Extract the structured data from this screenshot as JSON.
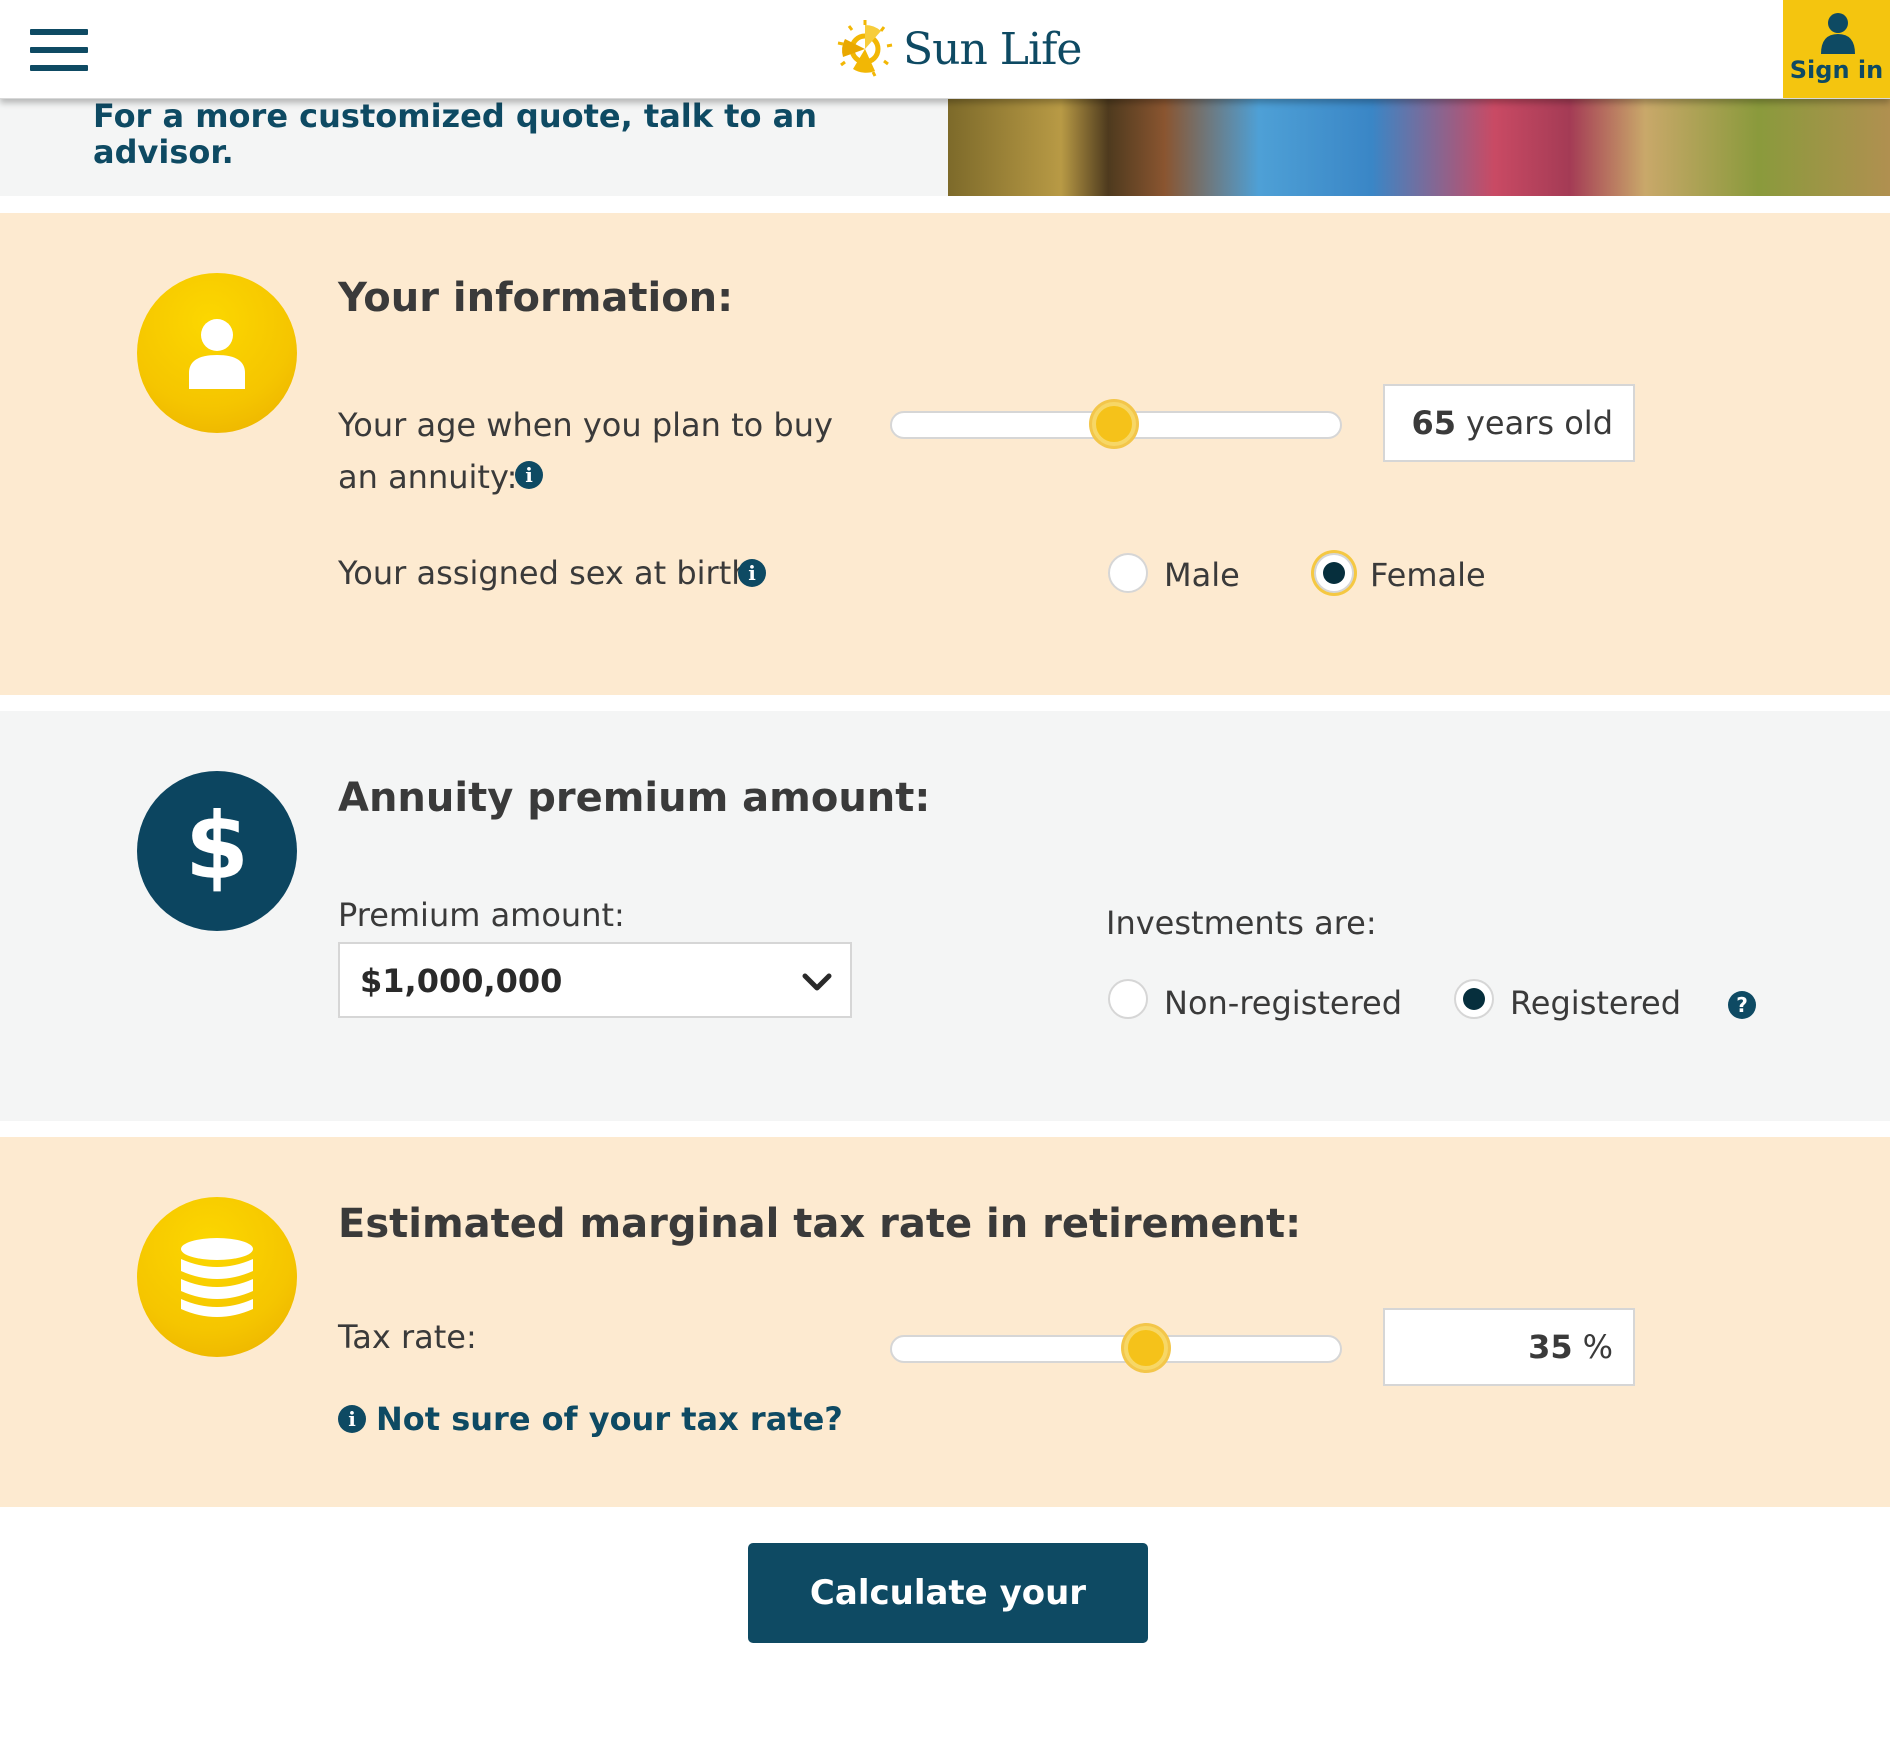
{
  "header": {
    "brand": "Sun Life",
    "signin_label": "Sign in"
  },
  "banner": {
    "text": "For a more customized quote, talk to an advisor."
  },
  "info_section": {
    "heading": "Your information:",
    "age_label_line1": "Your age when you plan to buy",
    "age_label_line2": "an annuity:",
    "age_value": "65",
    "age_unit": "years old",
    "age_slider_level": 0.5,
    "sex_label": "Your assigned sex at birth:",
    "sex_options": [
      "Male",
      "Female"
    ],
    "sex_selected": "Female"
  },
  "premium_section": {
    "heading": "Annuity premium amount:",
    "premium_label": "Premium amount:",
    "premium_value": "$1,000,000",
    "investments_label": "Investments are:",
    "investment_options": [
      "Non-registered",
      "Registered"
    ],
    "investment_selected": "Registered"
  },
  "tax_section": {
    "heading": "Estimated marginal tax rate in retirement:",
    "tax_label": "Tax rate:",
    "tax_value": "35",
    "tax_unit": "%",
    "tax_slider_level": 0.58,
    "help_link": "Not sure of your tax rate?"
  },
  "cta": {
    "label": "Calculate your results"
  },
  "colors": {
    "brand_navy": "#0e4a63",
    "brand_yellow": "#f4c50f",
    "section_peach": "#fdead0",
    "section_gray": "#f4f5f5"
  },
  "icons": [
    "hamburger-menu-icon",
    "sun-logo-icon",
    "user-icon",
    "person-icon",
    "dollar-icon",
    "coins-stack-icon",
    "info-icon",
    "question-icon",
    "chevron-down-icon"
  ]
}
